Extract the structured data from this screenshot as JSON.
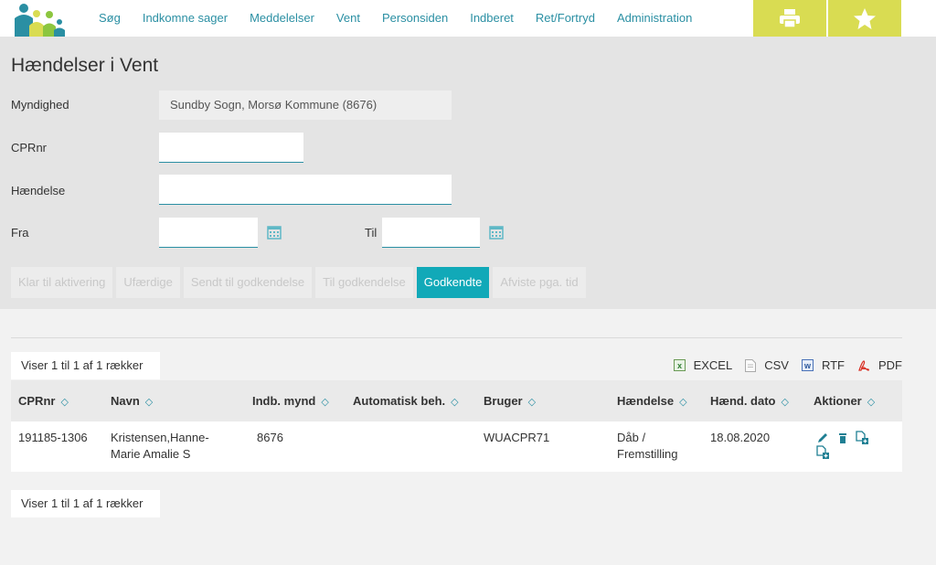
{
  "nav": {
    "items": [
      "Søg",
      "Indkomne sager",
      "Meddelelser",
      "Vent",
      "Personsiden",
      "Indberet",
      "Ret/Fortryd",
      "Administration"
    ]
  },
  "toolbar": {
    "print_icon": "print-icon",
    "favorite_icon": "star-icon",
    "accent": "#d9dc52"
  },
  "page": {
    "title": "Hændelser i Vent"
  },
  "form": {
    "myndighed_label": "Myndighed",
    "myndighed_value": "Sundby Sogn, Morsø Kommune (8676)",
    "cpr_label": "CPRnr",
    "cpr_value": "",
    "haendelse_label": "Hændelse",
    "haendelse_value": "",
    "fra_label": "Fra",
    "fra_value": "",
    "til_label": "Til",
    "til_value": ""
  },
  "tabs": [
    {
      "label": "Klar til aktivering",
      "active": false
    },
    {
      "label": "Ufærdige",
      "active": false
    },
    {
      "label": "Sendt til godkendelse",
      "active": false
    },
    {
      "label": "Til godkendelse",
      "active": false
    },
    {
      "label": "Godkendte",
      "active": true
    },
    {
      "label": "Afviste pga. tid",
      "active": false
    }
  ],
  "results": {
    "info_top": "Viser 1 til 1 af 1 rækker",
    "info_bottom": "Viser 1 til 1 af 1 rækker"
  },
  "exports": [
    {
      "label": "EXCEL",
      "icon": "excel-icon"
    },
    {
      "label": "CSV",
      "icon": "csv-icon"
    },
    {
      "label": "RTF",
      "icon": "rtf-icon"
    },
    {
      "label": "PDF",
      "icon": "pdf-icon"
    }
  ],
  "table": {
    "columns": [
      "CPRnr",
      "Navn",
      "Indb. mynd",
      "Automatisk beh.",
      "Bruger",
      "Hændelse",
      "Hænd. dato",
      "Aktioner"
    ],
    "rows": [
      {
        "cprnr": "191185-1306",
        "navn_line1": "Kristensen,Hanne-",
        "navn_line2": "Marie Amalie S",
        "indb_mynd": "8676",
        "automatisk": "",
        "bruger": "WUACPR71",
        "haendelse_line1": "Dåb /",
        "haendelse_line2": "Fremstilling",
        "dato": "18.08.2020",
        "actions": [
          "edit-icon",
          "delete-icon",
          "add-document-icon",
          "add-document-icon"
        ]
      }
    ]
  },
  "colors": {
    "link": "#2a8fa3",
    "active_tab": "#11a9b8",
    "panel": "#e4e4e4"
  }
}
